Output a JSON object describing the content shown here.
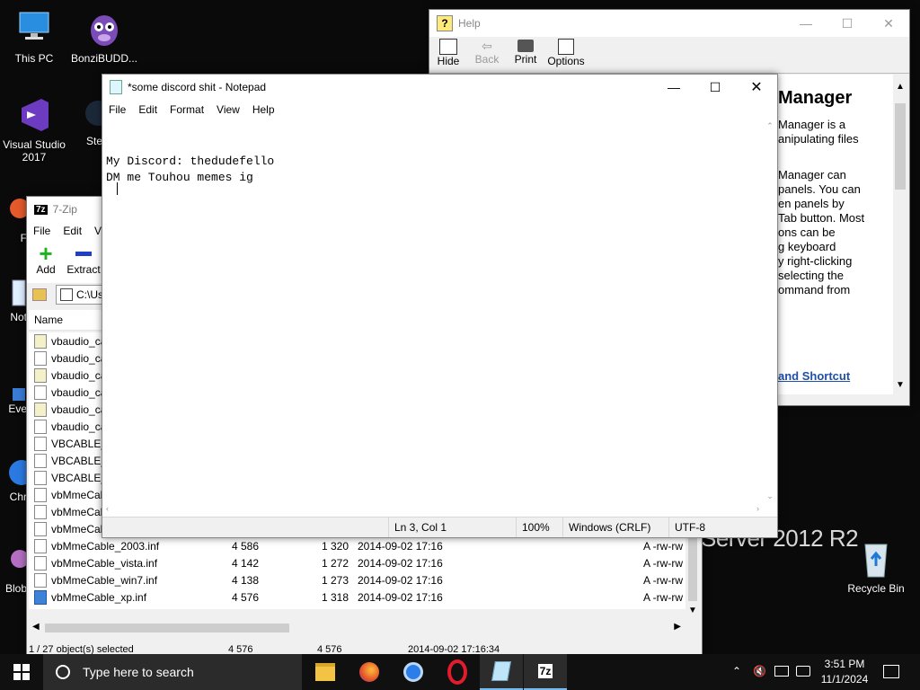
{
  "desktop": {
    "icons": [
      {
        "label": "This PC"
      },
      {
        "label": "BonziBUDD..."
      },
      {
        "label": "Visual Studio 2017"
      },
      {
        "label": "Ste"
      },
      {
        "label": "F"
      },
      {
        "label": "Not"
      },
      {
        "label": "Eve"
      },
      {
        "label": "Chr"
      },
      {
        "label": "Blob"
      },
      {
        "label": "Recycle Bin"
      }
    ],
    "wallpaper_text": "Server 2012 R2"
  },
  "help_window": {
    "title": "Help",
    "toolbar": [
      {
        "label": "Hide"
      },
      {
        "label": "Back"
      },
      {
        "label": "Print"
      },
      {
        "label": "Options"
      }
    ],
    "heading": "Manager",
    "lines": [
      "Manager is a",
      "anipulating files",
      "",
      "Manager can",
      "panels. You can",
      "en panels by",
      "Tab button. Most",
      "ons can be",
      "g keyboard",
      "y right-clicking",
      "selecting the",
      "ommand from"
    ],
    "link": "and Shortcut"
  },
  "sevenzip": {
    "title": "7-Zip",
    "menu": [
      "File",
      "Edit",
      "Vi"
    ],
    "toolbar": [
      {
        "label": "Add"
      },
      {
        "label": "Extract"
      }
    ],
    "path": "C:\\Us",
    "column_name": "Name",
    "rows": [
      {
        "name": "vbaudio_ca",
        "size": "",
        "packed": "",
        "modified": "",
        "attr": ""
      },
      {
        "name": "vbaudio_ca",
        "size": "",
        "packed": "",
        "modified": "",
        "attr": ""
      },
      {
        "name": "vbaudio_ca",
        "size": "",
        "packed": "",
        "modified": "",
        "attr": ""
      },
      {
        "name": "vbaudio_ca",
        "size": "",
        "packed": "",
        "modified": "",
        "attr": ""
      },
      {
        "name": "vbaudio_ca",
        "size": "",
        "packed": "",
        "modified": "",
        "attr": ""
      },
      {
        "name": "vbaudio_ca",
        "size": "",
        "packed": "",
        "modified": "",
        "attr": ""
      },
      {
        "name": "VBCABLE_C",
        "size": "",
        "packed": "",
        "modified": "",
        "attr": ""
      },
      {
        "name": "VBCABLE_S",
        "size": "",
        "packed": "",
        "modified": "",
        "attr": ""
      },
      {
        "name": "VBCABLE_S",
        "size": "",
        "packed": "",
        "modified": "",
        "attr": ""
      },
      {
        "name": "vbMmeCab",
        "size": "",
        "packed": "",
        "modified": "",
        "attr": ""
      },
      {
        "name": "vbMmeCab",
        "size": "",
        "packed": "",
        "modified": "",
        "attr": ""
      },
      {
        "name": "vbMmeCab",
        "size": "",
        "packed": "",
        "modified": "",
        "attr": ""
      },
      {
        "name": "vbMmeCable_2003.inf",
        "size": "4 586",
        "packed": "1 320",
        "modified": "2014-09-02 17:16",
        "attr": "A -rw-rw"
      },
      {
        "name": "vbMmeCable_vista.inf",
        "size": "4 142",
        "packed": "1 272",
        "modified": "2014-09-02 17:16",
        "attr": "A -rw-rw"
      },
      {
        "name": "vbMmeCable_win7.inf",
        "size": "4 138",
        "packed": "1 273",
        "modified": "2014-09-02 17:16",
        "attr": "A -rw-rw"
      },
      {
        "name": "vbMmeCable_xp.inf",
        "size": "4 576",
        "packed": "1 318",
        "modified": "2014-09-02 17:16",
        "attr": "A -rw-rw"
      }
    ],
    "status": {
      "selected": "1 / 27 object(s) selected",
      "size": "4 576",
      "packed": "4 576",
      "modified": "2014-09-02 17:16:34"
    }
  },
  "notepad": {
    "title": "*some discord shit - Notepad",
    "menu": [
      "File",
      "Edit",
      "Format",
      "View",
      "Help"
    ],
    "text": "My Discord: thedudefello\nDM me Touhou memes ig",
    "status": {
      "position": "Ln 3, Col 1",
      "zoom": "100%",
      "line_ending": "Windows (CRLF)",
      "encoding": "UTF-8"
    }
  },
  "taskbar": {
    "search_placeholder": "Type here to search",
    "time": "3:51 PM",
    "date": "11/1/2024",
    "apps": [
      "file-explorer",
      "firefox",
      "chrome",
      "opera",
      "notepad",
      "7-zip"
    ]
  }
}
